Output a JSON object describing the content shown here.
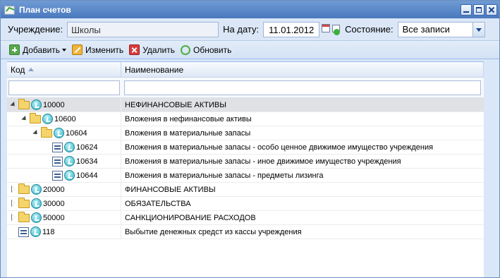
{
  "window": {
    "title": "План счетов",
    "controls": [
      "minimize-icon",
      "maximize-icon",
      "close-icon"
    ]
  },
  "filters": {
    "institution_label": "Учреждение:",
    "institution_value": "Школы",
    "date_label": "На дату:",
    "date_value": "11.01.2012",
    "state_label": "Состояние:",
    "state_value": "Все записи"
  },
  "toolbar": {
    "add": "Добавить",
    "edit": "Изменить",
    "delete": "Удалить",
    "refresh": "Обновить"
  },
  "grid": {
    "col_code": "Код",
    "col_name": "Наименование",
    "rows": [
      {
        "code": "10000",
        "name": "НЕФИНАНСОВЫЕ АКТИВЫ",
        "level": 0,
        "type": "folder",
        "expander": "open",
        "selected": true
      },
      {
        "code": "10600",
        "name": "Вложения в нефинансовые активы",
        "level": 1,
        "type": "folder",
        "expander": "open",
        "selected": false
      },
      {
        "code": "10604",
        "name": "Вложения в материальные запасы",
        "level": 2,
        "type": "folder",
        "expander": "open",
        "selected": false
      },
      {
        "code": "10624",
        "name": "Вложения в материальные запасы - особо ценное движимое имущество учреждения",
        "level": 3,
        "type": "account",
        "expander": "none",
        "selected": false
      },
      {
        "code": "10634",
        "name": "Вложения в материальные запасы - иное движимое имущество учреждения",
        "level": 3,
        "type": "account",
        "expander": "none",
        "selected": false
      },
      {
        "code": "10644",
        "name": "Вложения в материальные запасы - предметы лизинга",
        "level": 3,
        "type": "account",
        "expander": "none",
        "selected": false
      },
      {
        "code": "20000",
        "name": "ФИНАНСОВЫЕ АКТИВЫ",
        "level": 0,
        "type": "folder",
        "expander": "closed",
        "selected": false
      },
      {
        "code": "30000",
        "name": "ОБЯЗАТЕЛЬСТВА",
        "level": 0,
        "type": "folder",
        "expander": "closed",
        "selected": false
      },
      {
        "code": "50000",
        "name": "САНКЦИОНИРОВАНИЕ РАСХОДОВ",
        "level": 0,
        "type": "folder",
        "expander": "closed",
        "selected": false
      },
      {
        "code": "118",
        "name": "Выбытие денежных средст из кассы учреждения",
        "level": 0,
        "type": "account",
        "expander": "none",
        "selected": false
      }
    ]
  }
}
